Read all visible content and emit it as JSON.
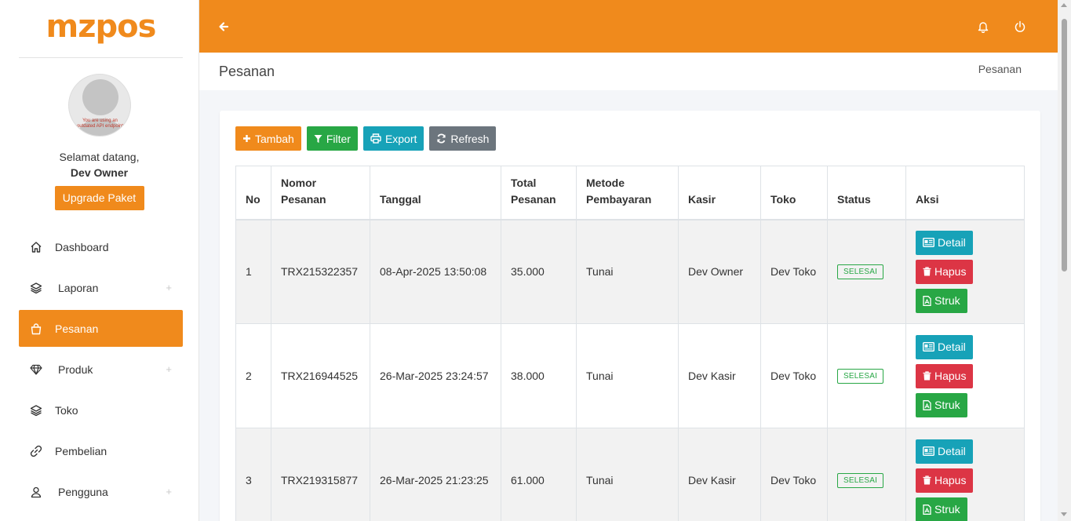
{
  "brand": {
    "logo_text": "mzpos",
    "accent": "#f08a1c"
  },
  "user": {
    "avatar_note": "You are using an outdated API endpoint",
    "welcome": "Selamat datang,",
    "name": "Dev Owner",
    "upgrade_label": "Upgrade Paket"
  },
  "sidebar": {
    "items": [
      {
        "label": "Dashboard",
        "icon": "home-icon",
        "expandable": false,
        "active": false
      },
      {
        "label": "Laporan",
        "icon": "layers-icon",
        "expandable": true,
        "active": false
      },
      {
        "label": "Pesanan",
        "icon": "shopping-bag-icon",
        "expandable": false,
        "active": true
      },
      {
        "label": "Produk",
        "icon": "diamond-icon",
        "expandable": true,
        "active": false
      },
      {
        "label": "Toko",
        "icon": "layers-icon",
        "expandable": false,
        "active": false
      },
      {
        "label": "Pembelian",
        "icon": "link-icon",
        "expandable": false,
        "active": false
      },
      {
        "label": "Pengguna",
        "icon": "user-icon",
        "expandable": true,
        "active": false
      }
    ],
    "plus_symbol": "+"
  },
  "page": {
    "title": "Pesanan",
    "breadcrumb": "Pesanan"
  },
  "toolbar": {
    "tambah": "Tambah",
    "filter": "Filter",
    "export": "Export",
    "refresh": "Refresh"
  },
  "table": {
    "headers": {
      "no": "No",
      "nomor_1": "Nomor",
      "nomor_2": "Pesanan",
      "tanggal": "Tanggal",
      "total_1": "Total",
      "total_2": "Pesanan",
      "metode_1": "Metode",
      "metode_2": "Pembayaran",
      "kasir": "Kasir",
      "toko": "Toko",
      "status": "Status",
      "aksi": "Aksi"
    },
    "rows": [
      {
        "no": "1",
        "nomor": "TRX215322357",
        "tanggal": "08-Apr-2025 13:50:08",
        "total": "35.000",
        "metode": "Tunai",
        "kasir": "Dev Owner",
        "toko": "Dev Toko",
        "status": "SELESAI"
      },
      {
        "no": "2",
        "nomor": "TRX216944525",
        "tanggal": "26-Mar-2025 23:24:57",
        "total": "38.000",
        "metode": "Tunai",
        "kasir": "Dev Kasir",
        "toko": "Dev Toko",
        "status": "SELESAI"
      },
      {
        "no": "3",
        "nomor": "TRX219315877",
        "tanggal": "26-Mar-2025 21:23:25",
        "total": "61.000",
        "metode": "Tunai",
        "kasir": "Dev Kasir",
        "toko": "Dev Toko",
        "status": "SELESAI"
      }
    ],
    "actions": {
      "detail": "Detail",
      "hapus": "Hapus",
      "struk": "Struk"
    }
  }
}
